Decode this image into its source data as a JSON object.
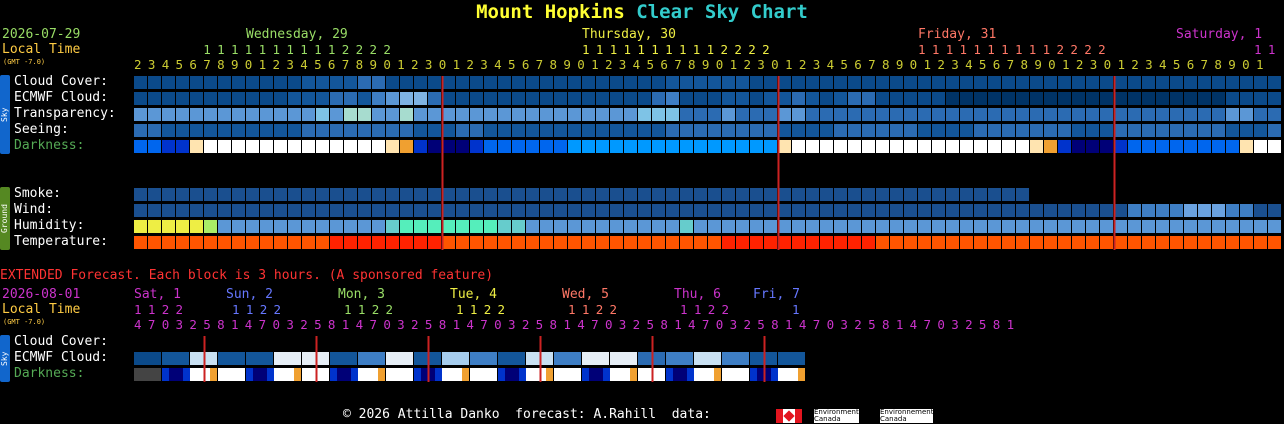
{
  "title_part1": "Mount Hopkins",
  "title_part2": "Clear Sky Chart",
  "main": {
    "date": "2026-07-29",
    "local_time_label": "Local Time",
    "gmt_label": "(GMT -7.0)",
    "day_headers": [
      {
        "label": "Wednesday, 29",
        "color": "#99dd66"
      },
      {
        "label": "Thursday, 30",
        "color": "#eeee44"
      },
      {
        "label": "Friday, 31",
        "color": "#ff7766"
      },
      {
        "label": "Saturday, 1",
        "color": "#cc33cc"
      }
    ],
    "tens_rows": [
      "          1 1 1 1 1 1 1 1 1 1 2 2 2 2",
      "1 1 1 1 1 1 1 1 1 1 2 2 2 2",
      "1 1 1 1 1 1 1 1 1 1 2 2 2 2",
      "1 1"
    ],
    "hours_row": "2 3 4 5 6 7 8 9 0 1 2 3 4 5 6 7 8 9 0 1 2 3 0 1 2 3 4 5 6 7 8 9 0 1 2 3 4 5 6 7 8 9 0 1 2 3 0 1 2 3 4 5 6 7 8 9 0 1 2 3 4 5 6 7 8 9 0 1 2 3 0 1 2 3 4 5 6 7 8 9 0 1",
    "sky_sidebar": "Sky",
    "ground_sidebar": "Ground",
    "rows_sky": [
      "Cloud Cover:",
      "ECMWF Cloud:",
      "Transparency:",
      "Seeing:",
      "Darkness:"
    ],
    "rows_ground": [
      "Smoke:",
      "Wind:",
      "Humidity:",
      "Temperature:"
    ]
  },
  "extended": {
    "banner": "EXTENDED Forecast. Each block is 3 hours. (A sponsored feature)",
    "date": "2026-08-01",
    "local_time_label": "Local Time",
    "gmt_label": "(GMT -7.0)",
    "day_headers": [
      {
        "label": "Sat, 1",
        "color": "#cc33cc"
      },
      {
        "label": "Sun, 2",
        "color": "#6677ff"
      },
      {
        "label": "Mon, 3",
        "color": "#99dd66"
      },
      {
        "label": "Tue, 4",
        "color": "#eeee44"
      },
      {
        "label": "Wed, 5",
        "color": "#ff7766"
      },
      {
        "label": "Thu, 6",
        "color": "#cc33cc"
      },
      {
        "label": "Fri, 7",
        "color": "#6677ff"
      }
    ],
    "tens_rows": [
      "1 1 2 2",
      "1 1 2 2",
      "1 1 2 2",
      "1 1 2 2",
      "1 1 2 2",
      "1 1 2 2",
      "1"
    ],
    "hours_row": "4 7 0 3 2 5 8 1 4 7 0 3 2 5 8 1 4 7 0 3 2 5 8 1 4 7 0 3 2 5 8 1 4 7 0 3 2 5 8 1 4 7 0 3 2 5 8 1 4 7 0 3 2 5 8 1 4 7 0 3 2 5 8 1",
    "sky_sidebar": "Sky",
    "rows": [
      "Cloud Cover:",
      "ECMWF Cloud:",
      "Darkness:"
    ]
  },
  "footer": {
    "text": "© 2026 Attilla Danko  forecast: A.Rahill  data:",
    "agency_en": "Environment\nCanada",
    "agency_fr": "Environnement\nCanada"
  },
  "colors": {
    "label": "#ffffff",
    "darkness_label": "#55aa55",
    "date": "#99dd66",
    "local_time": "#ffcc44",
    "hours": "#cccc33",
    "banner": "#ff3333",
    "midnight_line": "#cc2222",
    "sky_bar": "#1166cc",
    "ground_bar": "#558822"
  },
  "chart_data": {
    "type": "heatmap",
    "block_hours_main": 1,
    "block_hours_extended": 3,
    "main_blocks": 82,
    "extended_blocks": 24,
    "legend_note": "cloud: 0=clear(dark blue) … 10=overcast(white); darkness: 0=dark … 10=daylight",
    "main": {
      "cloud_cover": [
        1,
        1,
        1,
        1,
        1,
        1,
        1,
        1,
        1,
        1,
        1,
        1,
        2,
        2,
        2,
        2,
        3,
        3,
        1,
        1,
        1,
        1,
        1,
        1,
        1,
        1,
        1,
        1,
        1,
        1,
        1,
        1,
        1,
        1,
        1,
        1,
        1,
        1,
        2,
        2,
        2,
        2,
        2,
        2,
        1,
        1,
        1,
        1,
        1,
        1,
        1,
        1,
        1,
        1,
        1,
        1,
        1,
        1,
        1,
        1,
        1,
        1,
        1,
        1,
        1,
        1,
        1,
        1,
        1,
        1,
        1,
        1,
        1,
        1,
        1,
        1,
        1,
        1,
        1,
        1,
        1,
        1
      ],
      "ecmwf_cloud": [
        1,
        1,
        1,
        1,
        1,
        1,
        1,
        1,
        1,
        1,
        1,
        2,
        2,
        2,
        3,
        3,
        2,
        4,
        5,
        6,
        6,
        3,
        1,
        1,
        1,
        1,
        1,
        1,
        1,
        1,
        1,
        1,
        1,
        1,
        1,
        1,
        1,
        3,
        4,
        1,
        1,
        1,
        2,
        2,
        1,
        2,
        2,
        3,
        2,
        1,
        2,
        3,
        3,
        1,
        1,
        1,
        1,
        1,
        0,
        0,
        0,
        0,
        0,
        0,
        0,
        0,
        0,
        0,
        0,
        0,
        0,
        0,
        0,
        0,
        0,
        0,
        0,
        0,
        1,
        1,
        1,
        1
      ],
      "transparency": [
        5,
        5,
        5,
        5,
        5,
        5,
        5,
        5,
        5,
        5,
        5,
        5,
        5,
        6,
        5,
        7,
        7,
        5,
        5,
        7,
        5,
        5,
        5,
        5,
        5,
        5,
        5,
        5,
        5,
        5,
        5,
        5,
        5,
        5,
        5,
        5,
        6,
        6,
        6,
        3,
        3,
        3,
        5,
        3,
        3,
        3,
        5,
        5,
        3,
        3,
        3,
        3,
        3,
        3,
        3,
        3,
        3,
        3,
        3,
        3,
        3,
        3,
        3,
        3,
        3,
        3,
        3,
        3,
        3,
        3,
        3,
        3,
        3,
        3,
        3,
        3,
        3,
        3,
        5,
        5,
        3,
        3
      ],
      "seeing": [
        3,
        3,
        2,
        2,
        2,
        2,
        2,
        2,
        2,
        2,
        2,
        2,
        3,
        3,
        3,
        3,
        3,
        3,
        3,
        3,
        2,
        2,
        2,
        3,
        3,
        2,
        2,
        2,
        2,
        2,
        2,
        2,
        2,
        2,
        2,
        2,
        2,
        2,
        3,
        3,
        3,
        3,
        3,
        3,
        3,
        3,
        2,
        2,
        2,
        2,
        3,
        3,
        3,
        3,
        3,
        3,
        2,
        2,
        2,
        2,
        3,
        3,
        3,
        3,
        3,
        3,
        3,
        2,
        2,
        2,
        3,
        3,
        3,
        3,
        3,
        3,
        3,
        3,
        2,
        2,
        2,
        3
      ],
      "darkness": [
        -2,
        -2,
        -3,
        -3,
        9,
        10,
        10,
        10,
        10,
        10,
        10,
        10,
        10,
        10,
        10,
        10,
        10,
        10,
        9,
        6,
        -3,
        -4,
        -4,
        -4,
        -3,
        -2,
        -2,
        -2,
        -2,
        -2,
        -2,
        -1,
        -1,
        -1,
        -1,
        -1,
        -1,
        -1,
        -1,
        -1,
        -1,
        -1,
        -1,
        -1,
        -1,
        -1,
        9,
        10,
        10,
        10,
        10,
        10,
        10,
        10,
        10,
        10,
        10,
        10,
        10,
        10,
        10,
        10,
        10,
        10,
        9,
        6,
        -3,
        -4,
        -4,
        -4,
        -3,
        -2,
        -2,
        -2,
        -2,
        -2,
        -2,
        -2,
        -2,
        9,
        10,
        10
      ],
      "smoke": [
        1,
        1,
        1,
        1,
        1,
        1,
        1,
        1,
        1,
        1,
        1,
        1,
        1,
        1,
        1,
        1,
        1,
        1,
        1,
        1,
        1,
        1,
        1,
        1,
        1,
        1,
        1,
        1,
        1,
        1,
        1,
        1,
        1,
        1,
        1,
        1,
        1,
        1,
        1,
        1,
        1,
        1,
        1,
        1,
        1,
        1,
        1,
        1,
        1,
        1,
        1,
        1,
        1,
        1,
        1,
        1,
        1,
        1,
        1,
        1,
        1,
        1,
        1,
        1,
        null,
        null,
        null,
        null,
        null,
        null,
        null,
        null,
        null,
        null,
        null,
        null,
        null,
        null,
        null,
        null,
        null,
        null
      ],
      "wind": [
        1,
        1,
        1,
        1,
        1,
        1,
        1,
        1,
        1,
        1,
        1,
        1,
        1,
        1,
        1,
        1,
        1,
        1,
        1,
        1,
        1,
        1,
        1,
        1,
        1,
        1,
        1,
        1,
        1,
        1,
        1,
        1,
        1,
        1,
        1,
        1,
        1,
        1,
        1,
        1,
        1,
        1,
        1,
        1,
        1,
        1,
        1,
        1,
        1,
        1,
        1,
        1,
        1,
        1,
        1,
        1,
        1,
        1,
        1,
        1,
        1,
        1,
        1,
        1,
        1,
        1,
        1,
        1,
        1,
        1,
        1,
        2,
        2,
        2,
        2,
        3,
        3,
        3,
        2,
        2,
        1,
        1
      ],
      "humidity": [
        9,
        9,
        9,
        9,
        9,
        8,
        5,
        5,
        5,
        5,
        5,
        5,
        5,
        5,
        5,
        5,
        5,
        5,
        6,
        7,
        7,
        7,
        7,
        7,
        7,
        7,
        6,
        6,
        5,
        5,
        5,
        5,
        5,
        5,
        5,
        5,
        5,
        5,
        5,
        6,
        5,
        5,
        5,
        5,
        5,
        5,
        5,
        5,
        5,
        5,
        5,
        5,
        5,
        5,
        5,
        5,
        5,
        5,
        5,
        5,
        5,
        5,
        5,
        5,
        5,
        5,
        5,
        5,
        5,
        5,
        5,
        5,
        5,
        5,
        5,
        5,
        5,
        5,
        5,
        5,
        5,
        5
      ],
      "temperature": [
        6,
        6,
        6,
        6,
        6,
        6,
        6,
        6,
        6,
        6,
        6,
        6,
        6,
        6,
        7,
        7,
        7,
        7,
        7,
        7,
        7,
        7,
        6,
        6,
        6,
        6,
        6,
        6,
        6,
        6,
        6,
        6,
        6,
        6,
        6,
        6,
        6,
        6,
        6,
        6,
        6,
        6,
        7,
        7,
        7,
        7,
        7,
        7,
        7,
        7,
        7,
        7,
        7,
        6,
        6,
        6,
        6,
        6,
        6,
        6,
        6,
        6,
        6,
        6,
        6,
        6,
        6,
        6,
        6,
        6,
        6,
        6,
        6,
        6,
        6,
        6,
        6,
        6,
        6,
        6,
        6,
        6
      ]
    },
    "extended": {
      "cloud_cover": [],
      "ecmwf_cloud": [
        1,
        2,
        8,
        2,
        2,
        9,
        9,
        2,
        4,
        9,
        2,
        7,
        4,
        2,
        8,
        4,
        9,
        9,
        3,
        4,
        8,
        4,
        2,
        2
      ],
      "darkness": [
        8,
        -4,
        9,
        10,
        -4,
        9,
        10,
        -4,
        9,
        10,
        -4,
        9,
        10,
        -4,
        9,
        10,
        -4,
        9,
        10,
        -4,
        9,
        10,
        -4,
        9
      ]
    },
    "midnight_main_blocks": [
      22,
      46,
      70
    ],
    "midnight_extended_blocks": [
      2,
      6,
      10,
      14,
      18,
      22
    ]
  }
}
